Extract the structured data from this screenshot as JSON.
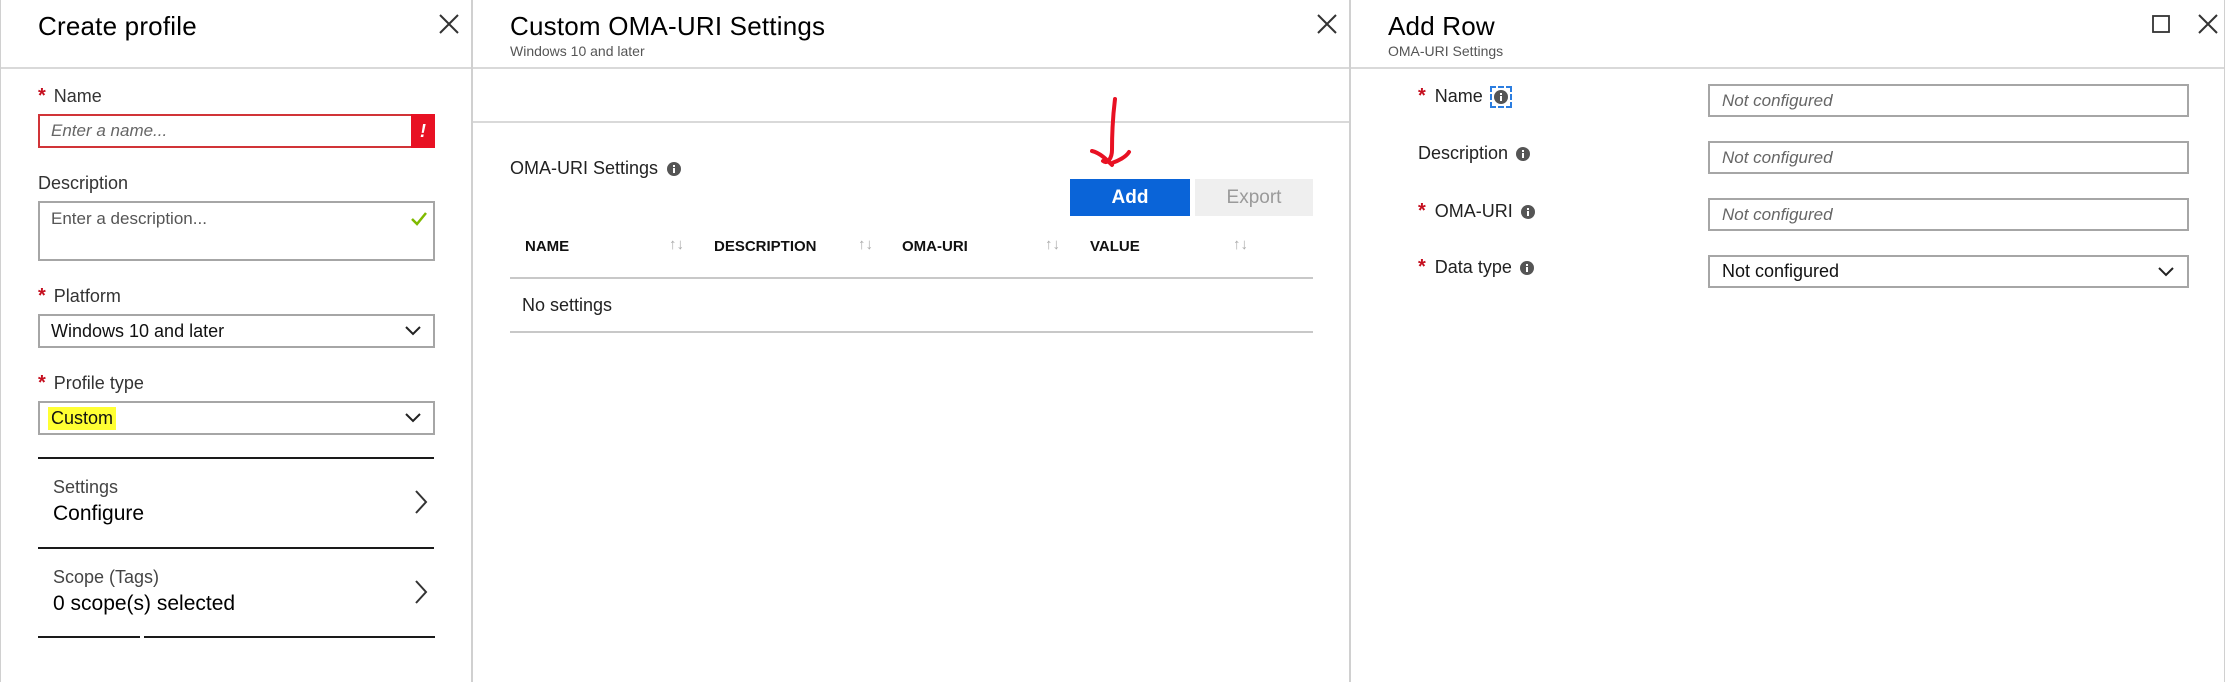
{
  "colors": {
    "accent": "#0a64d8",
    "required": "#c50f1f",
    "error": "#e81123",
    "success": "#7fba00",
    "highlight": "#ffff33",
    "annotation": "#e81123"
  },
  "create_profile": {
    "title": "Create profile",
    "close_icon": "close-icon",
    "name": {
      "label": "Name",
      "placeholder": "Enter a name...",
      "error_badge": "!"
    },
    "description": {
      "label": "Description",
      "placeholder": "Enter a description..."
    },
    "platform": {
      "label": "Platform",
      "value": "Windows 10 and later"
    },
    "profile_type": {
      "label": "Profile type",
      "value": "Custom"
    },
    "settings": {
      "label": "Settings",
      "value": "Configure"
    },
    "scope": {
      "label": "Scope (Tags)",
      "value": "0 scope(s) selected"
    },
    "required_mark": "*"
  },
  "custom_oma": {
    "title": "Custom OMA-URI Settings",
    "subtitle": "Windows 10 and later",
    "section_title": "OMA-URI Settings",
    "add_label": "Add",
    "export_label": "Export",
    "columns": [
      "NAME",
      "DESCRIPTION",
      "OMA-URI",
      "VALUE"
    ],
    "empty_text": "No settings"
  },
  "add_row": {
    "title": "Add Row",
    "subtitle": "OMA-URI Settings",
    "rows": [
      {
        "label": "Name",
        "required": true,
        "value": "Not configured"
      },
      {
        "label": "Description",
        "required": false,
        "value": "Not configured"
      },
      {
        "label": "OMA-URI",
        "required": true,
        "value": "Not configured"
      },
      {
        "label": "Data type",
        "required": true,
        "value": "Not configured"
      }
    ],
    "required_mark": "*"
  }
}
